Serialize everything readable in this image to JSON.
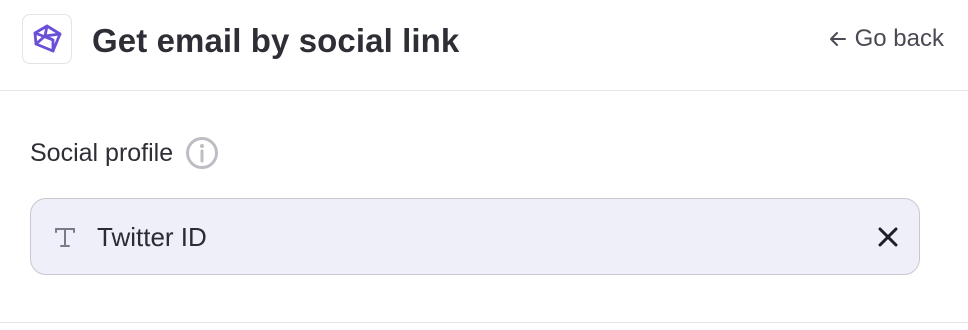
{
  "header": {
    "title": "Get email by social link",
    "logo_icon": "brand-logo-icon",
    "go_back": {
      "label": "Go back",
      "icon": "arrow-left-icon"
    }
  },
  "form": {
    "field": {
      "label": "Social profile",
      "info_icon": "info-icon",
      "type_icon": "text-type-icon",
      "value": "Twitter ID",
      "clear_icon": "close-icon"
    }
  },
  "colors": {
    "brand": "#6b4fd8",
    "field_background": "#efeffa",
    "field_border": "#c8c8d0",
    "divider": "#e6e6ea",
    "text": "#2e2e36",
    "muted_icon": "#bdbdc4"
  }
}
